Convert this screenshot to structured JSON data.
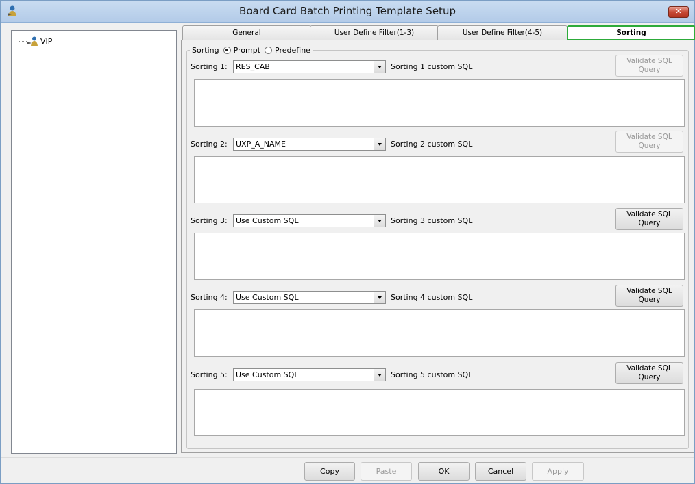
{
  "window": {
    "title": "Board Card Batch Printing Template Setup",
    "close_label": "✕"
  },
  "tree": {
    "items": [
      {
        "label": "VIP"
      }
    ]
  },
  "tabs": [
    {
      "label": "General",
      "active": false
    },
    {
      "label": "User Define Filter(1-3)",
      "active": false
    },
    {
      "label": "User Define Filter(4-5)",
      "active": false
    },
    {
      "label": "Sorting",
      "active": true
    }
  ],
  "sorting": {
    "group_label": "Sorting",
    "mode_options": [
      {
        "label": "Prompt",
        "checked": true
      },
      {
        "label": "Predefine",
        "checked": false
      }
    ],
    "rows": [
      {
        "label": "Sorting 1:",
        "value": "RES_CAB",
        "sql_label": "Sorting 1 custom SQL",
        "validate_label": "Validate SQL\nQuery",
        "validate_enabled": false,
        "sql_text": ""
      },
      {
        "label": "Sorting 2:",
        "value": "UXP_A_NAME",
        "sql_label": "Sorting 2 custom SQL",
        "validate_label": "Validate SQL\nQuery",
        "validate_enabled": false,
        "sql_text": ""
      },
      {
        "label": "Sorting 3:",
        "value": "Use Custom SQL",
        "sql_label": "Sorting 3 custom SQL",
        "validate_label": "Validate SQL\nQuery",
        "validate_enabled": true,
        "sql_text": ""
      },
      {
        "label": "Sorting 4:",
        "value": "Use Custom SQL",
        "sql_label": "Sorting 4 custom SQL",
        "validate_label": "Validate SQL\nQuery",
        "validate_enabled": true,
        "sql_text": ""
      },
      {
        "label": "Sorting 5:",
        "value": "Use Custom SQL",
        "sql_label": "Sorting 5 custom SQL",
        "validate_label": "Validate SQL\nQuery",
        "validate_enabled": true,
        "sql_text": ""
      }
    ]
  },
  "footer": {
    "buttons": [
      {
        "label": "Copy",
        "enabled": true
      },
      {
        "label": "Paste",
        "enabled": false
      },
      {
        "label": "OK",
        "enabled": true
      },
      {
        "label": "Cancel",
        "enabled": true
      },
      {
        "label": "Apply",
        "enabled": false
      }
    ]
  },
  "colors": {
    "active_tab_border": "#2dab3a",
    "titlebar": "#c9dcf1",
    "close_button": "#c74a36"
  }
}
